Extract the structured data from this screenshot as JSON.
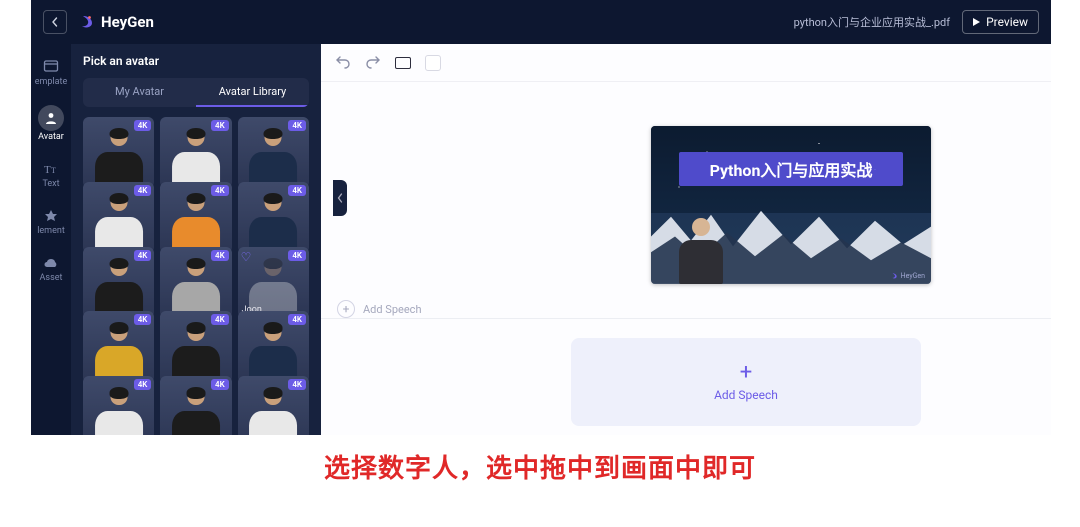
{
  "topbar": {
    "logo_text": "HeyGen",
    "doc_name": "python入门与企业应用实战_.pdf",
    "preview_label": "Preview"
  },
  "rail": {
    "items": [
      {
        "id": "template",
        "label": "emplate"
      },
      {
        "id": "avatar",
        "label": "Avatar"
      },
      {
        "id": "text",
        "label": "Text"
      },
      {
        "id": "element",
        "label": "lement"
      },
      {
        "id": "asset",
        "label": "Asset"
      }
    ]
  },
  "panel": {
    "title": "Pick an avatar",
    "tabs": {
      "mine": "My Avatar",
      "library": "Avatar Library"
    },
    "badge_4k": "4K",
    "selected_name": "Joon",
    "avatars": [
      {
        "torso": "c-black"
      },
      {
        "torso": "c-white"
      },
      {
        "torso": "c-navy"
      },
      {
        "torso": "c-white"
      },
      {
        "torso": "c-orange"
      },
      {
        "torso": "c-navy"
      },
      {
        "torso": "c-black"
      },
      {
        "torso": "c-grey"
      },
      {
        "torso": "c-white",
        "selected": true,
        "name_key": "panel.selected_name",
        "heart": true,
        "dim": true
      },
      {
        "torso": "c-yellow"
      },
      {
        "torso": "c-black"
      },
      {
        "torso": "c-navy"
      },
      {
        "torso": "c-white"
      },
      {
        "torso": "c-black"
      },
      {
        "torso": "c-white"
      }
    ]
  },
  "canvas": {
    "slide_title": "Python入门与应用实战",
    "slide_brand": "HeyGen",
    "add_speech_small": "Add Speech",
    "add_speech_big": "Add Speech"
  },
  "instruction": "选择数字人，选中拖中到画面中即可"
}
